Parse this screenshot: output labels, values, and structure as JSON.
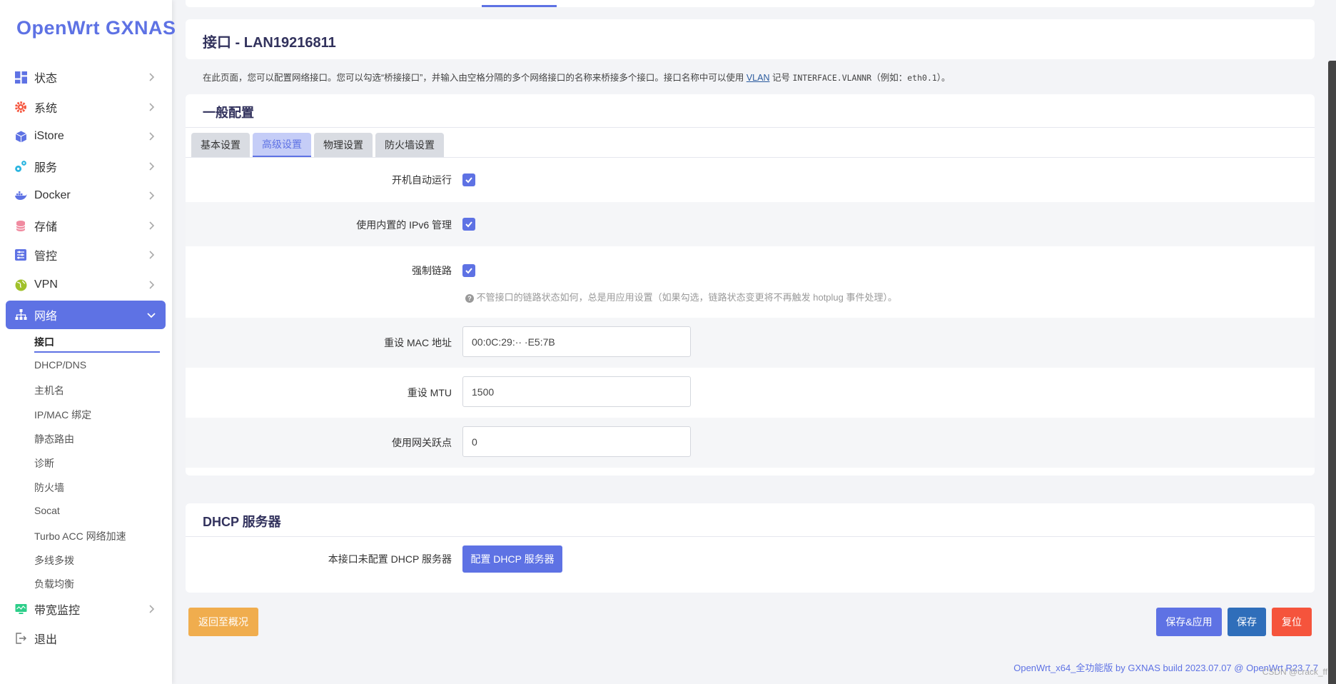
{
  "app": {
    "brand": "OpenWrt GXNAS"
  },
  "sidebar": {
    "items": [
      {
        "label": "状态",
        "icon": "dashboard-icon"
      },
      {
        "label": "系统",
        "icon": "gear-icon"
      },
      {
        "label": "iStore",
        "icon": "cube-icon"
      },
      {
        "label": "服务",
        "icon": "services-icon"
      },
      {
        "label": "Docker",
        "icon": "docker-icon"
      },
      {
        "label": "存储",
        "icon": "database-icon"
      },
      {
        "label": "管控",
        "icon": "sliders-icon"
      },
      {
        "label": "VPN",
        "icon": "globe-icon"
      },
      {
        "label": "网络",
        "icon": "network-icon"
      },
      {
        "label": "带宽监控",
        "icon": "monitor-icon"
      },
      {
        "label": "退出",
        "icon": "logout-icon"
      }
    ],
    "network_sub": [
      "接口",
      "DHCP/DNS",
      "主机名",
      "IP/MAC 绑定",
      "静态路由",
      "诊断",
      "防火墙",
      "Socat",
      "Turbo ACC 网络加速",
      "多线多拨",
      "负载均衡"
    ]
  },
  "page": {
    "title": "接口 - LAN19216811",
    "desc_before": "在此页面，您可以配置网络接口。您可以勾选“桥接接口”，并输入由空格分隔的多个网络接口的名称来桥接多个接口。接口名称中可以使用",
    "desc_link": "VLAN",
    "desc_mid": "记号",
    "desc_code": "INTERFACE.VLANNR",
    "desc_after": "（例如：",
    "desc_code2": "eth0.1",
    "desc_end": "）。"
  },
  "general": {
    "title": "一般配置",
    "tabs": [
      "基本设置",
      "高级设置",
      "物理设置",
      "防火墙设置"
    ],
    "fields": {
      "autostart_label": "开机自动运行",
      "ipv6_label": "使用内置的 IPv6 管理",
      "force_link_label": "强制链路",
      "force_link_hint": "不管接口的链路状态如何，总是用应用设置（如果勾选，链路状态变更将不再触发 hotplug 事件处理）。",
      "mac_label": "重设 MAC 地址",
      "mac_value": "00:0C:29:·· ·E5:7B",
      "mtu_label": "重设 MTU",
      "mtu_value": "1500",
      "metric_label": "使用网关跃点",
      "metric_value": "0"
    }
  },
  "dhcp": {
    "title": "DHCP 服务器",
    "label": "本接口未配置 DHCP 服务器",
    "button": "配置 DHCP 服务器"
  },
  "actions": {
    "back": "返回至概况",
    "save_apply": "保存&应用",
    "save": "保存",
    "reset": "复位"
  },
  "footer": {
    "text": "OpenWrt_x64_全功能版 by GXNAS build 2023.07.07 @ OpenWrt R23.7.7",
    "watermark": "CSDN @crack_ff"
  },
  "colors": {
    "accent": "#5e72e4",
    "warn": "#f0ad4e",
    "save": "#2f6eba",
    "reset": "#f5543c"
  }
}
